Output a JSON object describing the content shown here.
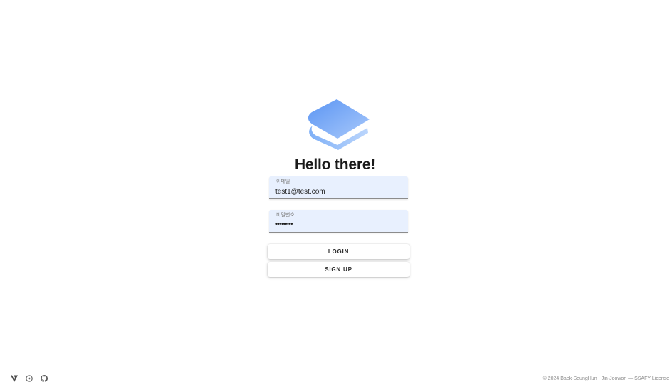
{
  "app": {
    "heading": "Hello there!",
    "logo_icon": "book-icon",
    "accent_color": "#7aa7f5"
  },
  "login_form": {
    "email_label": "이메일",
    "email_value": "test1@test.com",
    "password_label": "비밀번호",
    "password_value": "•••••••••",
    "login_label": "LOGIN",
    "signup_label": "SIGN UP",
    "field_background": "#e8f0fe"
  },
  "footer": {
    "icons": [
      "vuetify-icon",
      "settings-icon",
      "github-icon"
    ],
    "copyright": "© 2024 Baek-SeungHun · Jin-Joowon — SSAFY License"
  }
}
